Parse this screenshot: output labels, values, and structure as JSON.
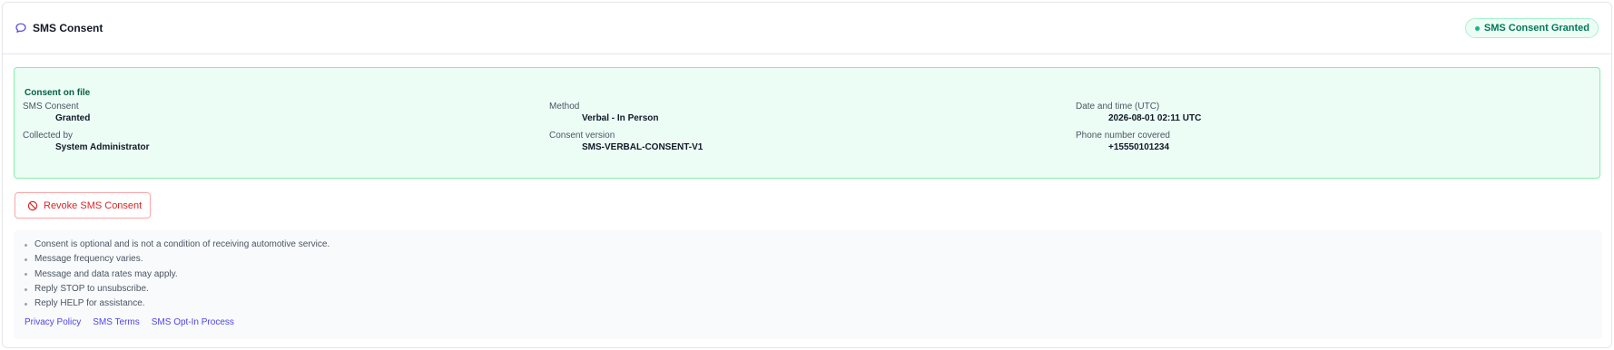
{
  "header": {
    "title": "SMS Consent",
    "icon": "chat-bubble-icon",
    "status_badge": "SMS Consent Granted"
  },
  "consent": {
    "heading": "Consent on file",
    "fields": [
      {
        "label": "SMS Consent",
        "value": "Granted"
      },
      {
        "label": "Method",
        "value": "Verbal - In Person"
      },
      {
        "label": "Date and time (UTC)",
        "value": "2026-08-01 02:11 UTC"
      },
      {
        "label": "Collected by",
        "value": "System Administrator"
      },
      {
        "label": "Consent version",
        "value": "SMS-VERBAL-CONSENT-V1"
      },
      {
        "label": "Phone number covered",
        "value": "+15550101234"
      }
    ]
  },
  "actions": {
    "revoke_label": "Revoke SMS Consent",
    "revoke_icon": "ban-icon"
  },
  "disclosures": {
    "items": [
      "Consent is optional and is not a condition of receiving automotive service.",
      "Message frequency varies.",
      "Message and data rates may apply.",
      "Reply STOP to unsubscribe.",
      "Reply HELP for assistance."
    ],
    "links": [
      "Privacy Policy",
      "SMS Terms",
      "SMS Opt-In Process"
    ]
  },
  "colors": {
    "accent": "#4f46e5",
    "success": "#047857",
    "danger": "#dc2626"
  }
}
